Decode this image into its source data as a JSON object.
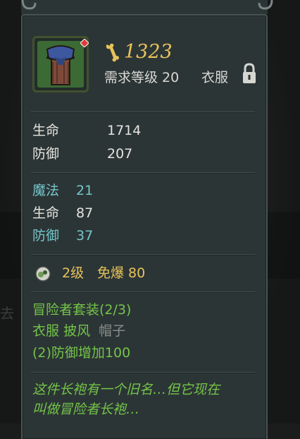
{
  "item": {
    "title": "",
    "value": "1323",
    "requirement": "需求等级 20",
    "type": "衣服",
    "colors": {
      "value": "#e9c25c",
      "green": "#73c448",
      "cyan": "#74c6c9",
      "panel": "#2c3536"
    }
  },
  "icons": {
    "item_icon": "robe-icon",
    "gem": "red-gem-icon",
    "currency": "bone-icon",
    "lock": "padlock-icon",
    "socket": "orb-icon"
  },
  "base_stats": [
    {
      "label": "生命",
      "value": "1714"
    },
    {
      "label": "防御",
      "value": "207"
    }
  ],
  "bonus_stats": [
    {
      "label": "魔法",
      "value": "21",
      "color": "cyan"
    },
    {
      "label": "生命",
      "value": "87",
      "color": "white"
    },
    {
      "label": "防御",
      "value": "37",
      "color": "cyan"
    }
  ],
  "socket": {
    "level": "2级",
    "effect": "免爆 80"
  },
  "set": {
    "name": "冒险者套装(2/3)",
    "piece1": "衣服",
    "piece2": "披风",
    "piece3": "帽子",
    "bonus": "(2)防御增加100"
  },
  "flavor": {
    "line1": "这件长袍有一个旧名…但它现在",
    "line2": "叫做冒险者长袍…"
  },
  "background": {
    "side_char": "去"
  }
}
